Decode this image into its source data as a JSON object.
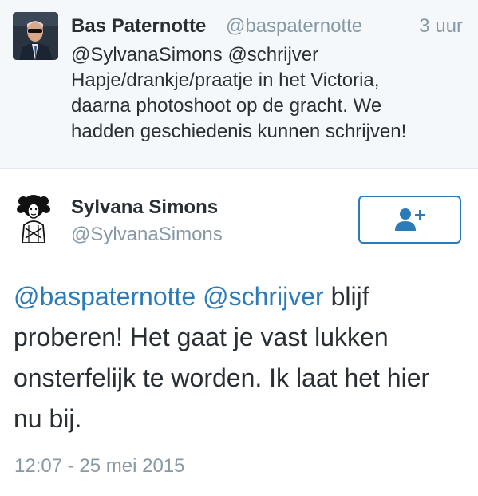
{
  "reply_tweet": {
    "author_name": "Bas Paternotte",
    "author_handle": "@baspaternotte",
    "time_ago": "3 uur",
    "text_lines": [
      "@SylvanaSimons @schrijver",
      "Hapje/drankje/praatje in het Victoria,",
      "daarna photoshoot op de gracht. We",
      "hadden geschiedenis kunnen schrijven!"
    ]
  },
  "main_tweet": {
    "author_name": "Sylvana Simons",
    "author_handle": "@SylvanaSimons",
    "follow_icon": "person-add-icon",
    "mention_1": "@baspaternotte",
    "mention_2": "@schrijver",
    "line_1_rest": " blijf",
    "text_lines": [
      "proberen! Het gaat je vast lukken",
      "onsterfelijk te worden. Ik laat het hier",
      "nu bij."
    ],
    "timestamp": "12:07 - 25 mei 2015"
  },
  "colors": {
    "link": "#2b7bb9",
    "text": "#292f33",
    "muted": "#8899a6",
    "reply_background": "#f5f8fa",
    "divider": "#e1e8ed"
  }
}
